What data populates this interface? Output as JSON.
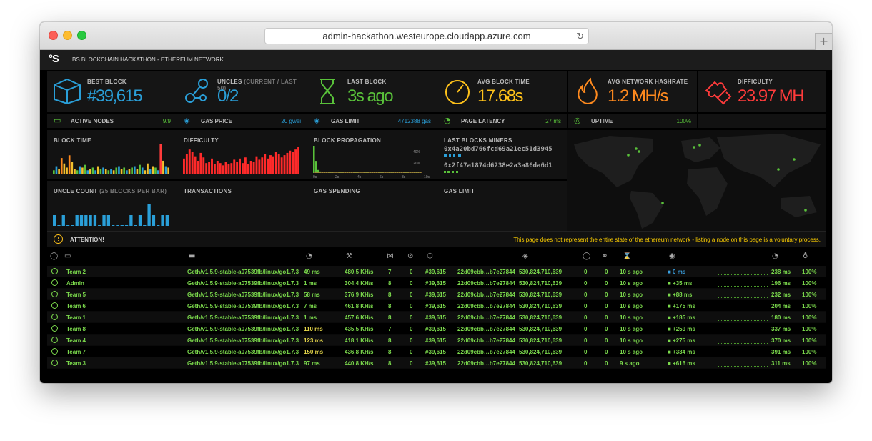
{
  "browser": {
    "url": "admin-hackathon.westeurope.cloudapp.azure.com",
    "new_tab": "+"
  },
  "app": {
    "logo": "BS",
    "title": "BS BLOCKCHAIN HACKATHON - ETHEREUM NETWORK"
  },
  "stats": [
    {
      "label": "BEST BLOCK",
      "sub": "",
      "value": "#39,615",
      "color": "#2a9fd8",
      "icon": "cube-icon"
    },
    {
      "label": "UNCLES",
      "sub": "(CURRENT / LAST 50)",
      "value": "0/2",
      "color": "#2a9fd8",
      "icon": "uncles-icon"
    },
    {
      "label": "LAST BLOCK",
      "sub": "",
      "value": "3s ago",
      "color": "#59c13a",
      "icon": "hourglass-icon"
    },
    {
      "label": "AVG BLOCK TIME",
      "sub": "",
      "value": "17.68s",
      "color": "#ffc21a",
      "icon": "gauge-icon"
    },
    {
      "label": "AVG NETWORK HASHRATE",
      "sub": "",
      "value": "1.2 MH/s",
      "color": "#ff8a1e",
      "icon": "flame-icon"
    },
    {
      "label": "DIFFICULTY",
      "sub": "",
      "value": "23.97 MH",
      "color": "#ff3b3b",
      "icon": "puzzle-icon"
    }
  ],
  "info": [
    {
      "label": "ACTIVE NODES",
      "value": "9/9",
      "color": "#59c13a",
      "icon": "computer-icon"
    },
    {
      "label": "GAS PRICE",
      "value": "20 gwei",
      "color": "#2a9fd8",
      "icon": "tag-icon"
    },
    {
      "label": "GAS LIMIT",
      "value": "4712388 gas",
      "color": "#2a9fd8",
      "icon": "tag-icon"
    },
    {
      "label": "PAGE LATENCY",
      "value": "27 ms",
      "color": "#59c13a",
      "icon": "timer-icon"
    },
    {
      "label": "UPTIME",
      "value": "100%",
      "color": "#59c13a",
      "icon": "bulb-icon"
    }
  ],
  "panels": {
    "block_time": "BLOCK TIME",
    "difficulty": "DIFFICULTY",
    "block_propagation": "BLOCK PROPAGATION",
    "last_miners": "LAST BLOCKS MINERS",
    "uncle_count": "UNCLE COUNT",
    "uncle_count_sub": "(25 BLOCKS PER BAR)",
    "transactions": "TRANSACTIONS",
    "gas_spending": "GAS SPENDING",
    "gas_limit": "GAS LIMIT"
  },
  "miners": [
    "0x4a20bd766fcd69a21ec51d3945",
    "0x2f47a1874d6238e2a3a86da6d1"
  ],
  "propagation": {
    "y_ticks": [
      "40%",
      "20%"
    ],
    "x_ticks": [
      "0s",
      "2s",
      "4s",
      "6s",
      "8s",
      "10s"
    ]
  },
  "chart_data": [
    {
      "type": "bar",
      "title": "BLOCK TIME",
      "values": [
        3,
        6,
        4,
        12,
        8,
        5,
        14,
        9,
        4,
        3,
        6,
        5,
        7,
        3,
        4,
        5,
        3,
        6,
        4,
        5,
        4,
        3,
        4,
        3,
        5,
        6,
        4,
        5,
        3,
        4,
        5,
        6,
        4,
        7,
        5,
        3,
        8,
        4,
        6,
        5,
        3,
        22,
        10,
        6,
        5
      ],
      "colors": [
        "#f2c12e",
        "#59c13a",
        "#2a9fd8",
        "#ff8a1e",
        "#ff3b3b"
      ]
    },
    {
      "type": "bar",
      "title": "DIFFICULTY",
      "values": [
        14,
        18,
        22,
        20,
        16,
        12,
        19,
        15,
        10,
        11,
        14,
        9,
        12,
        10,
        8,
        11,
        9,
        10,
        13,
        11,
        14,
        10,
        15,
        9,
        12,
        11,
        16,
        13,
        15,
        18,
        14,
        17,
        16,
        20,
        18,
        15,
        17,
        19,
        21,
        20,
        22,
        24
      ]
    },
    {
      "type": "bar",
      "title": "BLOCK PROPAGATION",
      "values": [
        36,
        16,
        4,
        2,
        1,
        1,
        1,
        1,
        1,
        1,
        1,
        1,
        1,
        1,
        1,
        1,
        1,
        1,
        1,
        1,
        1,
        1,
        1,
        1,
        1,
        1,
        1,
        1,
        1,
        1,
        1,
        1,
        1,
        1,
        1,
        1,
        1,
        1,
        1,
        1,
        1,
        1,
        1,
        1,
        1,
        1,
        1,
        1,
        1,
        1,
        1,
        1
      ]
    },
    {
      "type": "bar",
      "title": "UNCLE COUNT",
      "values": [
        1,
        0,
        1,
        0,
        0,
        1,
        1,
        1,
        1,
        1,
        0,
        1,
        1,
        0,
        0,
        0,
        0,
        1,
        0,
        1,
        0,
        2,
        1,
        0,
        1,
        1
      ]
    }
  ],
  "attention": {
    "label": "ATTENTION!",
    "message": "This page does not represent the entire state of the ethereum network - listing a node on this page is a voluntary process."
  },
  "nodes": [
    {
      "name": "Team 2",
      "client": "Geth/v1.5.9-stable-a07539fb/linux/go1.7.3",
      "latency": "49 ms",
      "hashrate": "480.5 KH/s",
      "peers": "7",
      "pending": "0",
      "block": "#39,615",
      "hash": "22d09cbb…b7e27844",
      "difficulty": "530,824,710,639",
      "uncles": "0",
      "txs": "0",
      "last": "10 s ago",
      "prop": "0 ms",
      "avgprop": "238 ms",
      "uptime": "100%"
    },
    {
      "name": "Admin",
      "client": "Geth/v1.5.9-stable-a07539fb/linux/go1.7.3",
      "latency": "1 ms",
      "hashrate": "304.4 KH/s",
      "peers": "8",
      "pending": "0",
      "block": "#39,615",
      "hash": "22d09cbb…b7e27844",
      "difficulty": "530,824,710,639",
      "uncles": "0",
      "txs": "0",
      "last": "10 s ago",
      "prop": "+35 ms",
      "avgprop": "196 ms",
      "uptime": "100%"
    },
    {
      "name": "Team 5",
      "client": "Geth/v1.5.9-stable-a07539fb/linux/go1.7.3",
      "latency": "58 ms",
      "hashrate": "376.9 KH/s",
      "peers": "8",
      "pending": "0",
      "block": "#39,615",
      "hash": "22d09cbb…b7e27844",
      "difficulty": "530,824,710,639",
      "uncles": "0",
      "txs": "0",
      "last": "10 s ago",
      "prop": "+88 ms",
      "avgprop": "232 ms",
      "uptime": "100%"
    },
    {
      "name": "Team 6",
      "client": "Geth/v1.5.9-stable-a07539fb/linux/go1.7.3",
      "latency": "7 ms",
      "hashrate": "461.8 KH/s",
      "peers": "8",
      "pending": "0",
      "block": "#39,615",
      "hash": "22d09cbb…b7e27844",
      "difficulty": "530,824,710,639",
      "uncles": "0",
      "txs": "0",
      "last": "10 s ago",
      "prop": "+175 ms",
      "avgprop": "204 ms",
      "uptime": "100%"
    },
    {
      "name": "Team 1",
      "client": "Geth/v1.5.9-stable-a07539fb/linux/go1.7.3",
      "latency": "1 ms",
      "hashrate": "457.6 KH/s",
      "peers": "8",
      "pending": "0",
      "block": "#39,615",
      "hash": "22d09cbb…b7e27844",
      "difficulty": "530,824,710,639",
      "uncles": "0",
      "txs": "0",
      "last": "10 s ago",
      "prop": "+185 ms",
      "avgprop": "180 ms",
      "uptime": "100%"
    },
    {
      "name": "Team 8",
      "client": "Geth/v1.5.9-stable-a07539fb/linux/go1.7.3",
      "latency": "110 ms",
      "hashrate": "435.5 KH/s",
      "peers": "7",
      "pending": "0",
      "block": "#39,615",
      "hash": "22d09cbb…b7e27844",
      "difficulty": "530,824,710,639",
      "uncles": "0",
      "txs": "0",
      "last": "10 s ago",
      "prop": "+259 ms",
      "avgprop": "337 ms",
      "uptime": "100%"
    },
    {
      "name": "Team 4",
      "client": "Geth/v1.5.9-stable-a07539fb/linux/go1.7.3",
      "latency": "123 ms",
      "hashrate": "418.1 KH/s",
      "peers": "8",
      "pending": "0",
      "block": "#39,615",
      "hash": "22d09cbb…b7e27844",
      "difficulty": "530,824,710,639",
      "uncles": "0",
      "txs": "0",
      "last": "10 s ago",
      "prop": "+275 ms",
      "avgprop": "370 ms",
      "uptime": "100%"
    },
    {
      "name": "Team 7",
      "client": "Geth/v1.5.9-stable-a07539fb/linux/go1.7.3",
      "latency": "150 ms",
      "hashrate": "436.8 KH/s",
      "peers": "8",
      "pending": "0",
      "block": "#39,615",
      "hash": "22d09cbb…b7e27844",
      "difficulty": "530,824,710,639",
      "uncles": "0",
      "txs": "0",
      "last": "10 s ago",
      "prop": "+334 ms",
      "avgprop": "391 ms",
      "uptime": "100%"
    },
    {
      "name": "Team 3",
      "client": "Geth/v1.5.9-stable-a07539fb/linux/go1.7.3",
      "latency": "97 ms",
      "hashrate": "440.8 KH/s",
      "peers": "8",
      "pending": "0",
      "block": "#39,615",
      "hash": "22d09cbb…b7e27844",
      "difficulty": "530,824,710,639",
      "uncles": "0",
      "txs": "0",
      "last": "9 s ago",
      "prop": "+616 ms",
      "avgprop": "311 ms",
      "uptime": "100%"
    }
  ]
}
